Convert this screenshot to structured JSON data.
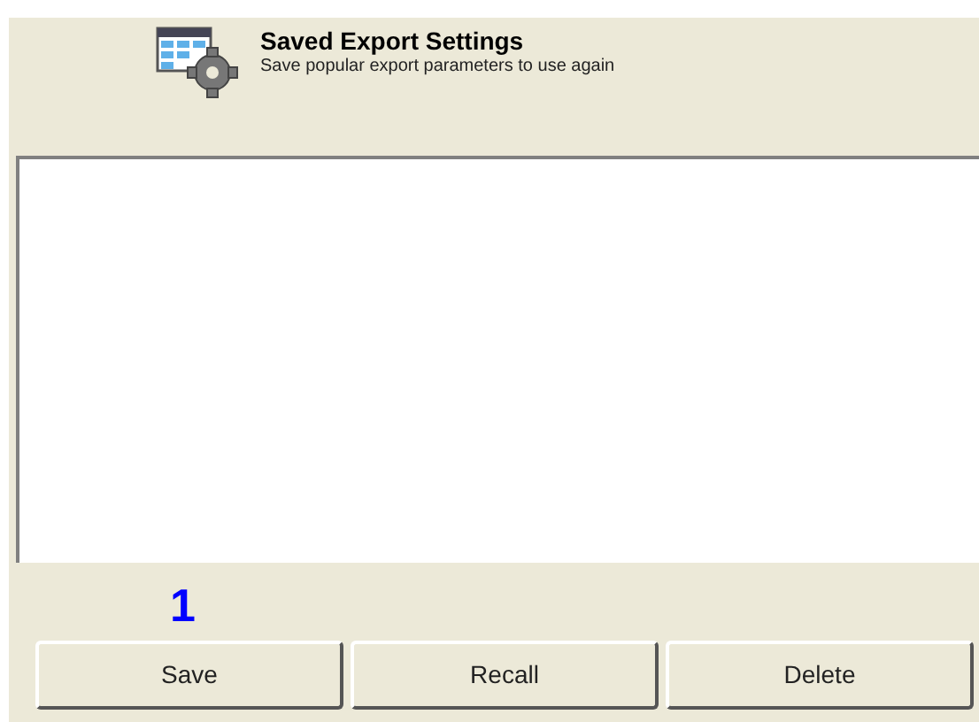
{
  "header": {
    "title": "Saved Export Settings",
    "subtitle": "Save popular export parameters to use again"
  },
  "annotation": "1",
  "buttons": [
    "Save",
    "Recall",
    "Delete"
  ]
}
